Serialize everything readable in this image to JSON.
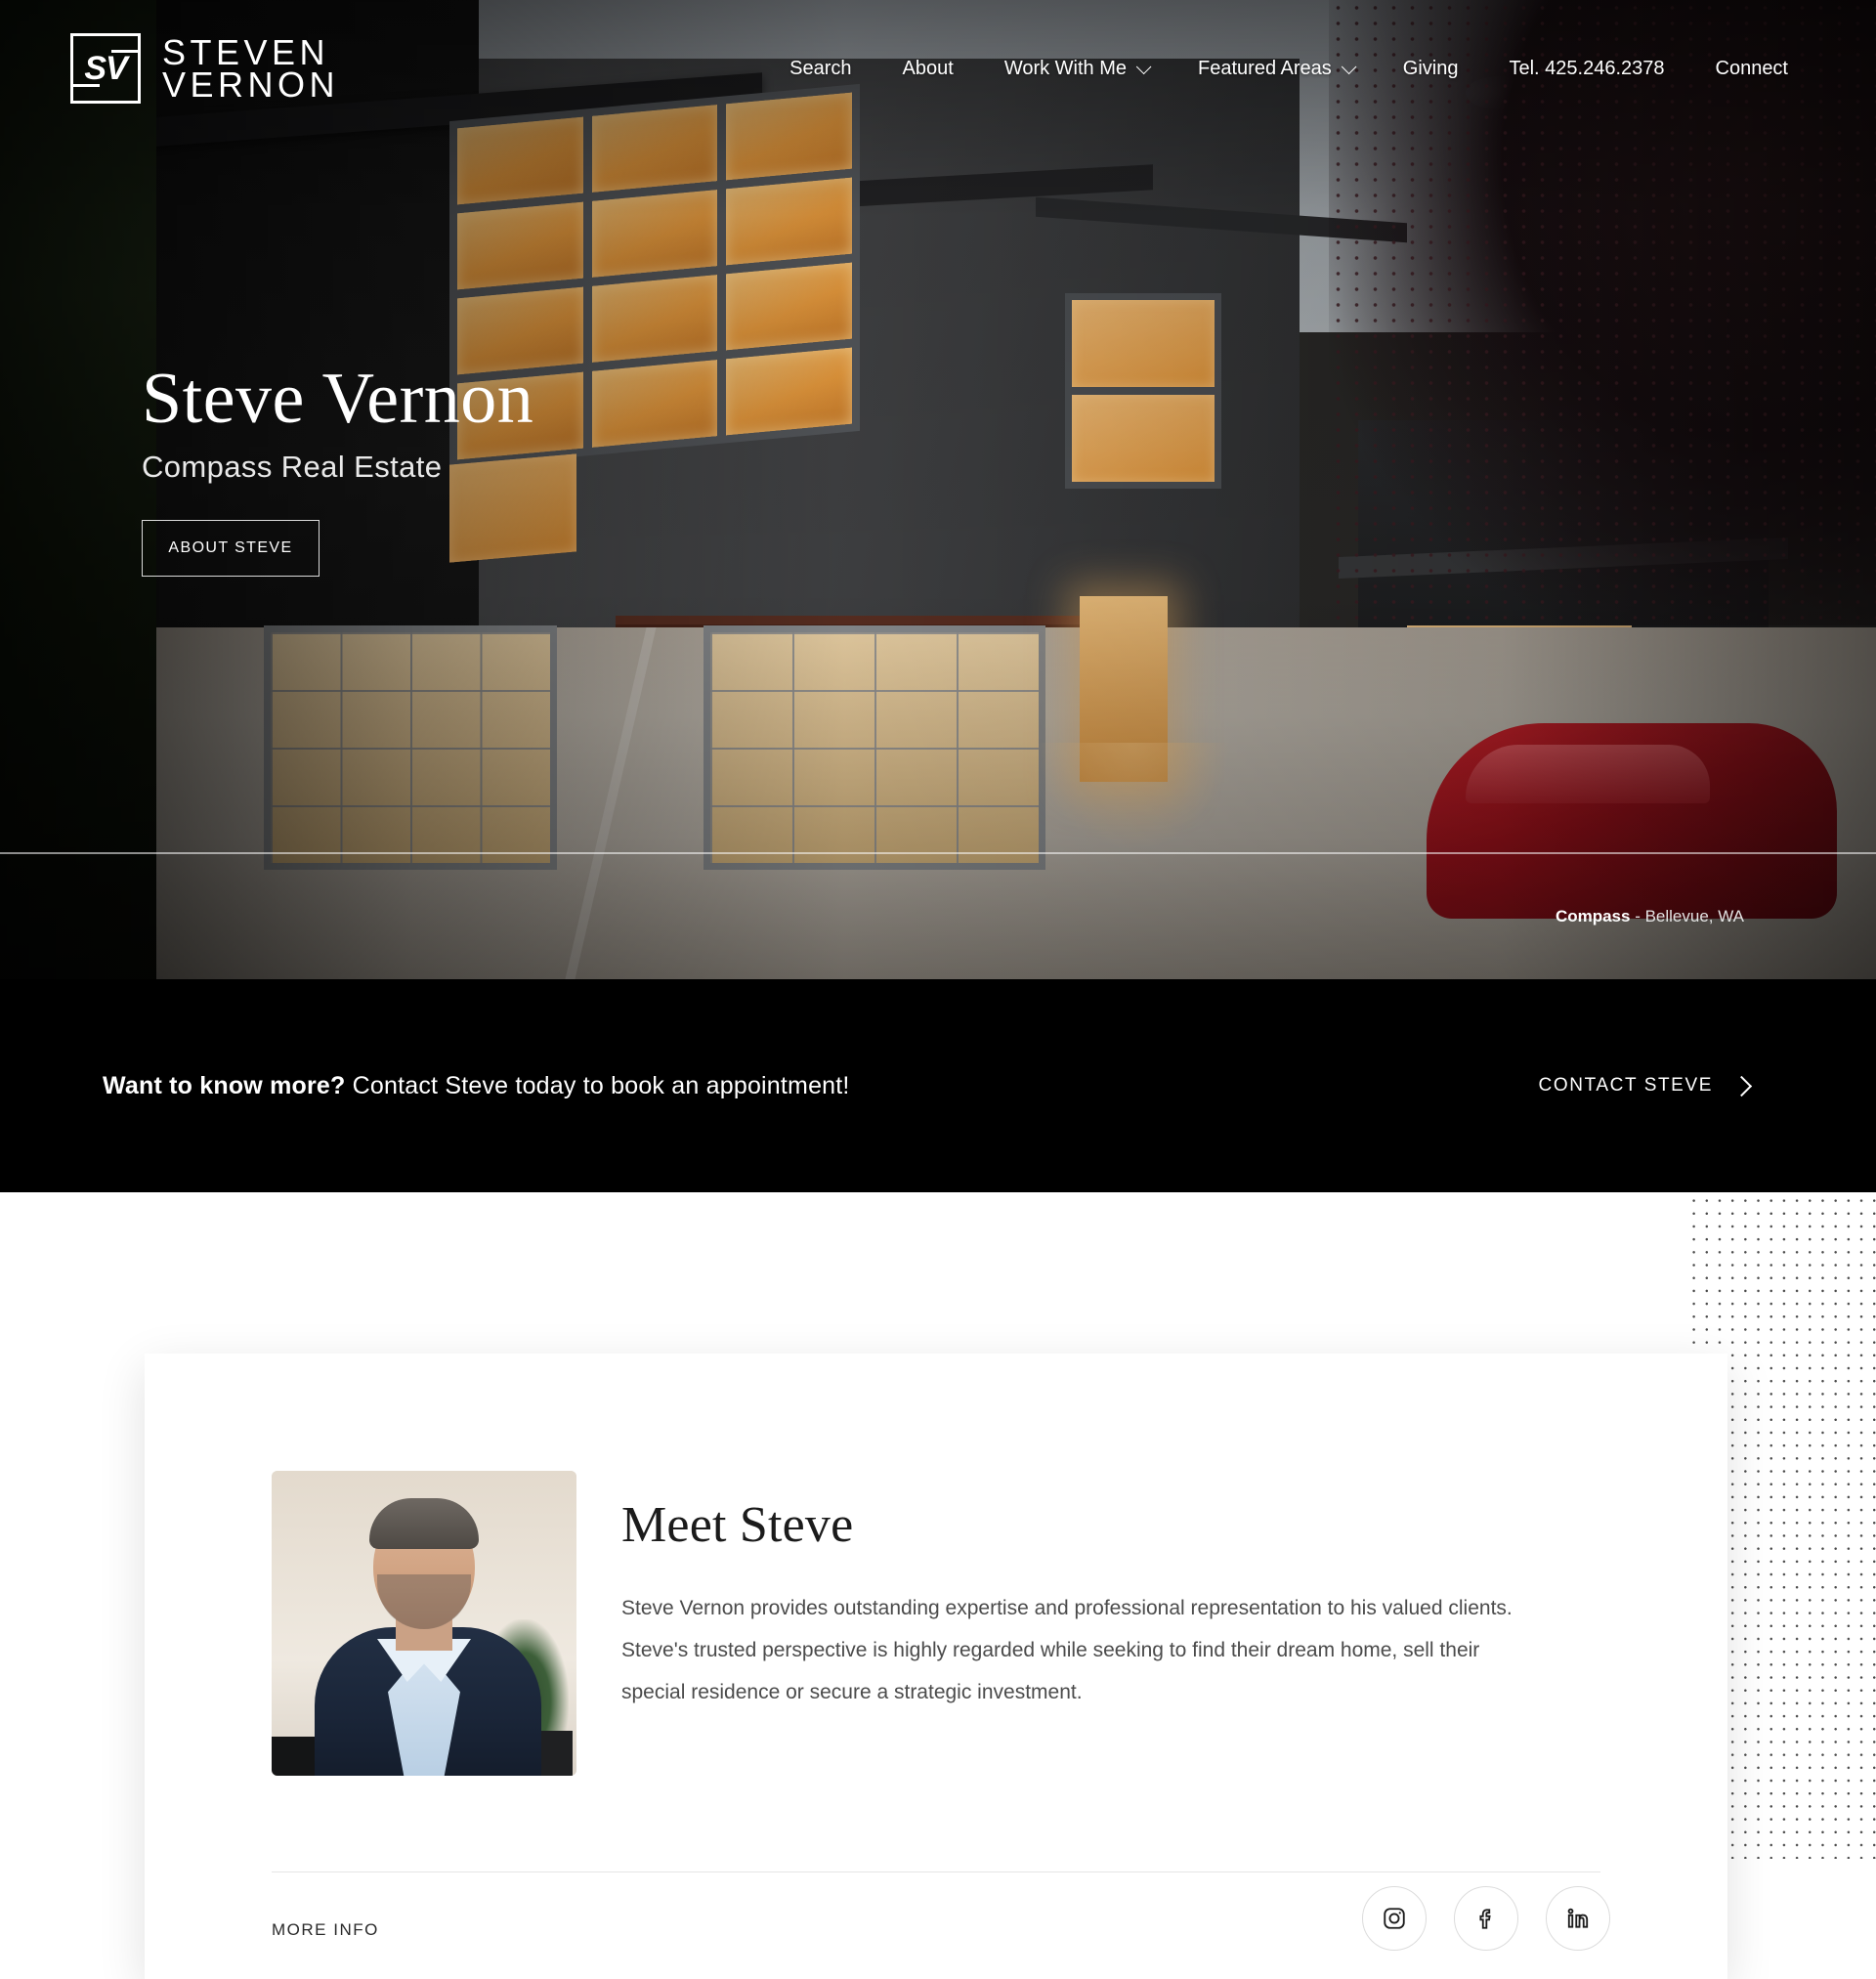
{
  "header": {
    "logo": {
      "mark": "SV",
      "line1": "STEVEN",
      "line2": "VERNON",
      "name": "steven-vernon-logo"
    },
    "nav": [
      {
        "label": "Search",
        "has_caret": false
      },
      {
        "label": "About",
        "has_caret": false
      },
      {
        "label": "Work With Me",
        "has_caret": true
      },
      {
        "label": "Featured Areas",
        "has_caret": true
      },
      {
        "label": "Giving",
        "has_caret": false
      },
      {
        "label": "Tel. 425.246.2378",
        "has_caret": false
      },
      {
        "label": "Connect",
        "has_caret": false
      }
    ]
  },
  "hero": {
    "title": "Steve Vernon",
    "subtitle": "Compass Real Estate",
    "button_label": "ABOUT STEVE",
    "watermark_brand": "Compass",
    "watermark_location": " - Bellevue, WA"
  },
  "cta": {
    "headline_bold": "Want to know more?",
    "headline_rest": " Contact Steve today to book an appointment!",
    "button_label": "CONTACT STEVE",
    "background_color": "#000000"
  },
  "meet": {
    "heading": "Meet Steve",
    "paragraph": "Steve Vernon provides outstanding expertise and professional representation to his valued clients.  Steve's trusted perspective is highly regarded while seeking to find their dream home, sell their special residence or secure a strategic investment.",
    "more_info_label": "MORE INFO",
    "socials": [
      {
        "name": "instagram",
        "label": "Instagram"
      },
      {
        "name": "facebook",
        "label": "Facebook"
      },
      {
        "name": "linkedin",
        "label": "LinkedIn"
      }
    ]
  }
}
